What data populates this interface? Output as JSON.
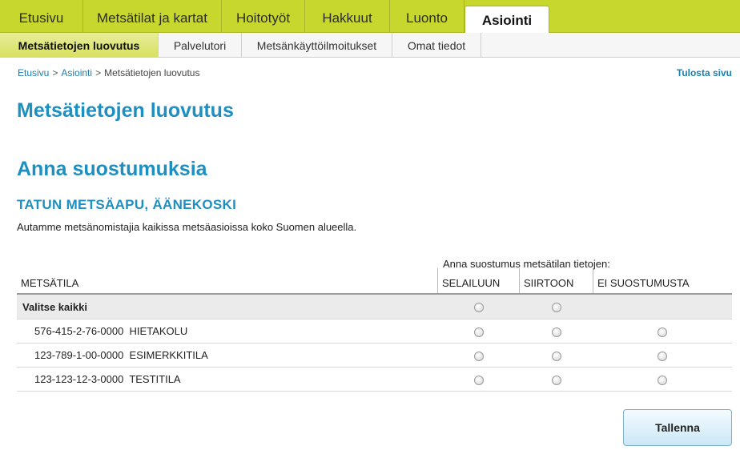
{
  "top_tabs": [
    "Etusivu",
    "Metsätilat ja kartat",
    "Hoitotyöt",
    "Hakkuut",
    "Luonto",
    "Asiointi"
  ],
  "top_tabs_active": "Asiointi",
  "sub_tabs": [
    "Metsätietojen luovutus",
    "Palvelutori",
    "Metsänkäyttöilmoitukset",
    "Omat tiedot"
  ],
  "sub_tabs_active": "Metsätietojen luovutus",
  "breadcrumb": [
    "Etusivu",
    "Asiointi",
    "Metsätietojen luovutus"
  ],
  "breadcrumb_separator": ">",
  "print_link": "Tulosta sivu",
  "page_title": "Metsätietojen luovutus",
  "section_title": "Anna suostumuksia",
  "org": {
    "name": "TATUN METSÄAPU, ÄÄNEKOSKI",
    "description": "Autamme metsänomistajia kaikissa metsäasioissa koko Suomen alueella."
  },
  "table": {
    "consent_heading": "Anna suostumus metsätilan tietojen:",
    "col_estate": "METSÄTILA",
    "col_browse": "SELAILUUN",
    "col_transfer": "SIIRTOON",
    "col_no_consent": "EI SUOSTUMUSTA",
    "select_all": "Valitse kaikki",
    "rows": [
      {
        "id": "576-415-2-76-0000",
        "name": "HIETAKOLU"
      },
      {
        "id": "123-789-1-00-0000",
        "name": "ESIMERKKITILA"
      },
      {
        "id": "123-123-12-3-0000",
        "name": "TESTITILA"
      }
    ]
  },
  "save_button": "Tallenna",
  "colors": {
    "accent_green": "#c8d72e",
    "title_blue": "#1d8fc1",
    "link_blue": "#1a7fb0"
  }
}
